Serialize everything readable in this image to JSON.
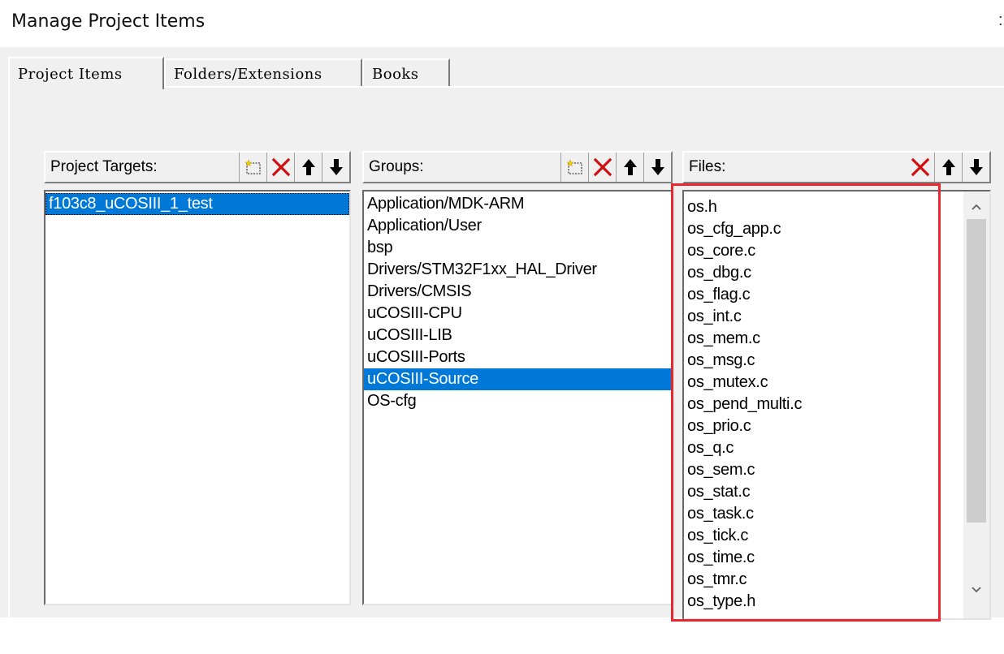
{
  "window": {
    "title": "Manage Project Items"
  },
  "tabs": [
    {
      "label": "Project Items",
      "active": true
    },
    {
      "label": "Folders/Extensions",
      "active": false
    },
    {
      "label": "Books",
      "active": false
    }
  ],
  "targets": {
    "label": "Project Targets:",
    "items": [
      "f103c8_uCOSIII_1_test"
    ],
    "selected_index": 0
  },
  "groups": {
    "label": "Groups:",
    "items": [
      "Application/MDK-ARM",
      "Application/User",
      "bsp",
      "Drivers/STM32F1xx_HAL_Driver",
      "Drivers/CMSIS",
      "uCOSIII-CPU",
      "uCOSIII-LIB",
      "uCOSIII-Ports",
      "uCOSIII-Source",
      "OS-cfg"
    ],
    "selected_index": 8
  },
  "files": {
    "label": "Files:",
    "items": [
      "os.h",
      "os_cfg_app.c",
      "os_core.c",
      "os_dbg.c",
      "os_flag.c",
      "os_int.c",
      "os_mem.c",
      "os_msg.c",
      "os_mutex.c",
      "os_pend_multi.c",
      "os_prio.c",
      "os_q.c",
      "os_sem.c",
      "os_stat.c",
      "os_task.c",
      "os_tick.c",
      "os_time.c",
      "os_tmr.c",
      "os_type.h"
    ]
  },
  "toolbar_icons": {
    "new": "new-item-icon",
    "delete": "delete-icon",
    "up": "move-up-icon",
    "down": "move-down-icon"
  },
  "colors": {
    "selection": "#0078d7",
    "highlight_box": "#e8272f",
    "delete_x": "#d01010"
  }
}
